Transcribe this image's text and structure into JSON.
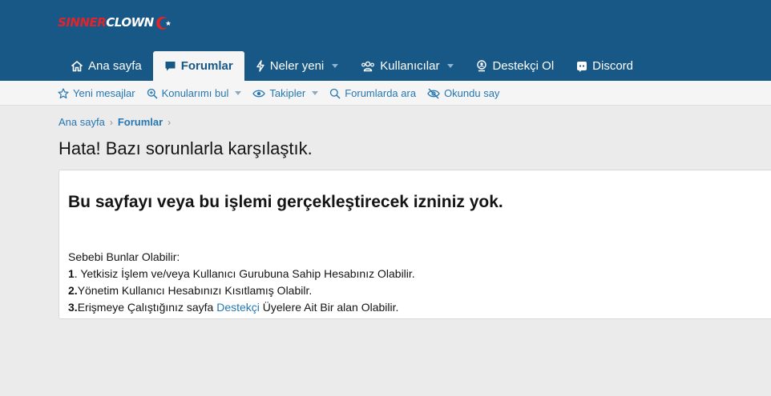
{
  "logo": {
    "part1": "SINNER",
    "part2": "CLOWN"
  },
  "nav": {
    "tabs": [
      {
        "label": "Ana sayfa",
        "icon": "home-icon"
      },
      {
        "label": "Forumlar",
        "icon": "comment-icon",
        "active": true
      },
      {
        "label": "Neler yeni",
        "icon": "bolt-icon"
      },
      {
        "label": "Kullanıcılar",
        "icon": "users-icon"
      },
      {
        "label": "Destekçi Ol",
        "icon": "badge-icon"
      },
      {
        "label": "Discord",
        "icon": "discord-icon"
      }
    ]
  },
  "subnav": {
    "items": [
      {
        "label": "Yeni mesajlar",
        "icon": "star-icon"
      },
      {
        "label": "Konularımı bul",
        "icon": "search-plus-icon"
      },
      {
        "label": "Takipler",
        "icon": "eye-icon"
      },
      {
        "label": "Forumlarda ara",
        "icon": "search-icon"
      },
      {
        "label": "Okundu say",
        "icon": "eye-slash-icon"
      }
    ]
  },
  "breadcrumb": {
    "home": "Ana sayfa",
    "current": "Forumlar"
  },
  "page_title": "Hata! Bazı sorunlarla karşılaştık.",
  "error": {
    "heading": "Bu sayfayı veya bu işlemi gerçekleştirecek izniniz yok.",
    "intro": "Sebebi Bunlar Olabilir:",
    "reasons": [
      {
        "num": "1",
        "text": ". Yetkisiz İşlem ve/veya Kullanıcı Gurubuna Sahip Hesabınız Olabilir."
      },
      {
        "num": "2.",
        "text": "Yönetim Kullanıcı Hesabınızı Kısıtlamış Olabilr."
      },
      {
        "num": "3.",
        "text_before": "Erişmeye Çalıştığınız sayfa ",
        "link": "Destekçi",
        "text_after": " Üyelere Ait Bir alan Olabilir."
      }
    ]
  },
  "colors": {
    "header": "#185886",
    "accent": "#2577b1",
    "brand_red": "#e0242c"
  }
}
